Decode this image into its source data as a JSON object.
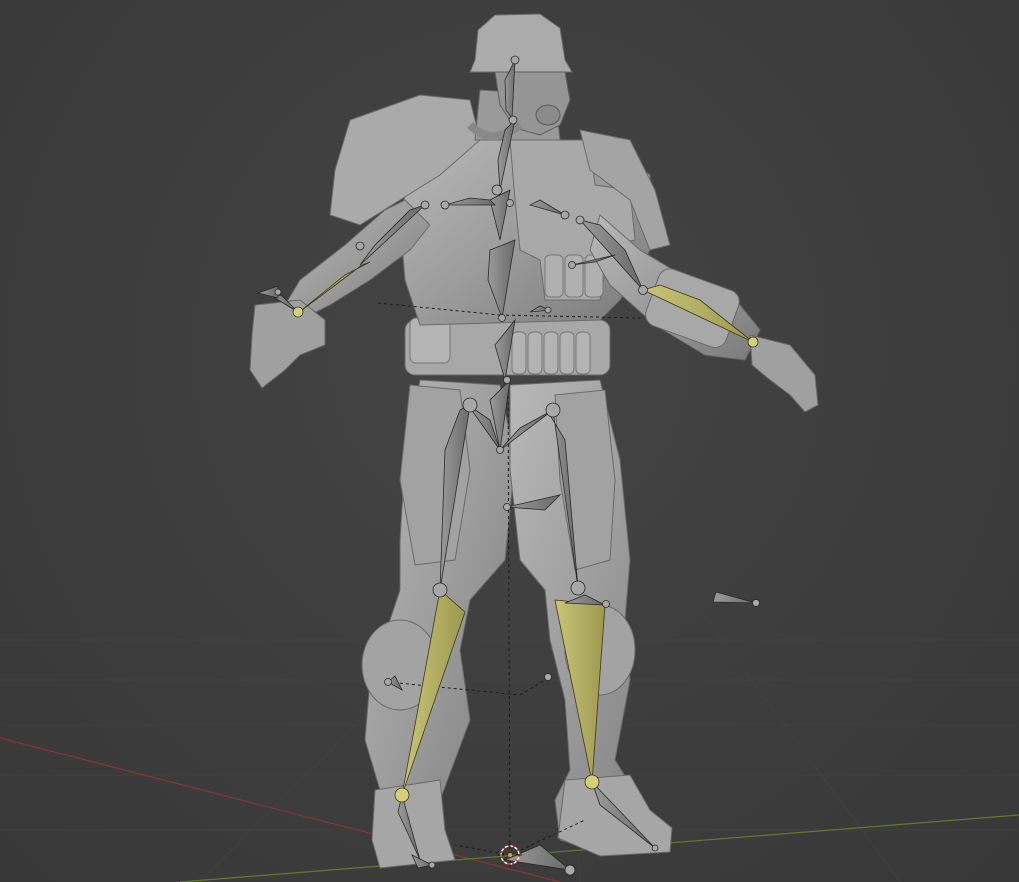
{
  "viewport": {
    "mode": "3d-viewport",
    "background_color": "#3d3d3d",
    "grid_color": "#4a4a4a",
    "x_axis_color": "#b03a3a",
    "y_axis_color": "#6b8f2e",
    "mesh_color": "#9a9a9a",
    "bone_color": "#8a8a8a",
    "selected_bone_color": "#b8b46a",
    "relationship_line_color": "#1a1a1a",
    "cursor_color": "#d64040"
  },
  "objects": {
    "mesh": "armored-soldier-mesh",
    "armature": "armature",
    "cursor": "3d-cursor"
  }
}
